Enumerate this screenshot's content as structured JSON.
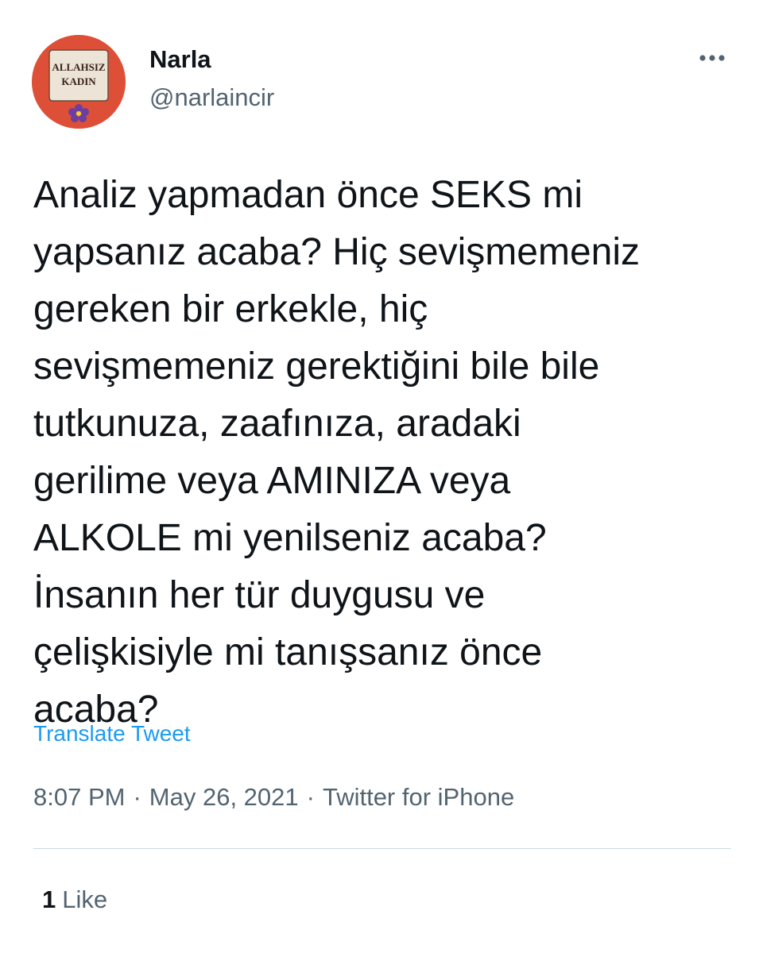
{
  "colors": {
    "text_primary": "#0f1419",
    "text_secondary": "#536471",
    "link": "#1d9bf0",
    "avatar_background": "#de4f37",
    "divider": "#cfd9de"
  },
  "author": {
    "name": "Narla",
    "handle": "@narlaincir",
    "avatar": {
      "line1": "ALLAHSIZ",
      "line2": "KADIN",
      "icon": "violet-flower-icon"
    }
  },
  "header": {
    "more_icon": "more-horizontal-icon"
  },
  "tweet": {
    "lines": [
      "Analiz yapmadan önce SEKS mi",
      "yapsanız acaba? Hiç sevişmemeniz",
      "gereken bir erkekle, hiç",
      "sevişmemeniz gerektiğini bile bile",
      "tutkunuza, zaafınıza, aradaki",
      "gerilime veya AMINIZA veya",
      "ALKOLE mi yenilseniz acaba?",
      "İnsanın her tür duygusu ve",
      "çelişkisiyle mi tanışsanız önce",
      "acaba?"
    ],
    "translate_label": "Translate Tweet"
  },
  "meta": {
    "time": "8:07 PM",
    "separator": "·",
    "date": "May 26, 2021",
    "source": "Twitter for iPhone"
  },
  "stats": {
    "likes_count": "1",
    "likes_label": "Like"
  }
}
